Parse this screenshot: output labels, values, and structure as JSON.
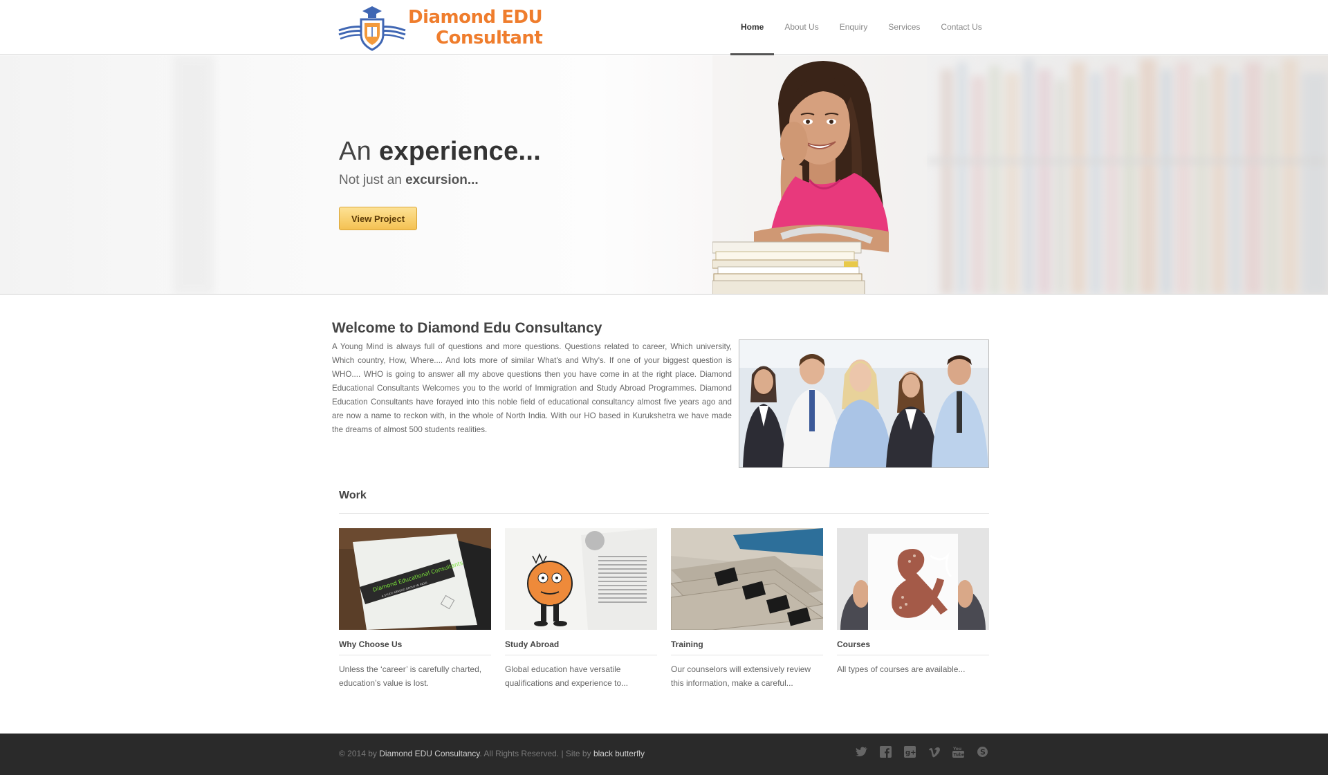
{
  "brand": {
    "line1": "Diamond EDU",
    "line2": "Consultant",
    "accent": "#ef7d2d",
    "shield_blue": "#3f66b3"
  },
  "nav": [
    {
      "label": "Home",
      "active": true
    },
    {
      "label": "About Us"
    },
    {
      "label": "Enquiry"
    },
    {
      "label": "Services"
    },
    {
      "label": "Contact Us"
    }
  ],
  "hero": {
    "title_light": "An",
    "title_bold": "experience...",
    "subtitle_light": "Not just an",
    "subtitle_bold": "excursion...",
    "button_label": "View Project"
  },
  "welcome": {
    "title": "Welcome to Diamond Edu Consultancy",
    "body": "A Young Mind is always full of questions and more questions. Questions related to career, Which university, Which country, How, Where.... And lots more of similar What's and Why's. If one of your biggest question is WHO.... WHO is going to answer all my above questions then you have come in at the right place. Diamond Educational Consultants Welcomes you to the world of Immigration and Study Abroad Programmes. Diamond Education Consultants have forayed into this noble field of educational consultancy almost five years ago and are now a name to reckon with, in the whole of North India. With our HO based in Kurukshetra we have made the dreams of almost 500 students realities."
  },
  "work": {
    "title": "Work",
    "items": [
      {
        "name": "Why Choose Us",
        "desc": "Unless the ‘career’ is carefully charted, education’s value is lost.",
        "image_text": "Diamond Educational Consultants",
        "image_subtext": "A STUDY ABROAD GROUP IN INDIA"
      },
      {
        "name": "Study Abroad",
        "desc": "Global education have versatile qualifications and experience to..."
      },
      {
        "name": "Training",
        "desc": "Our counselors will extensively review this information, make a careful..."
      },
      {
        "name": "Courses",
        "desc": "All types of courses are available..."
      }
    ]
  },
  "footer": {
    "copyright_prefix": "© 2014 by",
    "company": "Diamond EDU Consultancy",
    "middle": ". All Rights Reserved. | Site by",
    "designer": "black butterfly",
    "social_icons": [
      "twitter-icon",
      "facebook-icon",
      "google-plus-icon",
      "vimeo-icon",
      "youtube-icon",
      "skype-icon"
    ]
  }
}
